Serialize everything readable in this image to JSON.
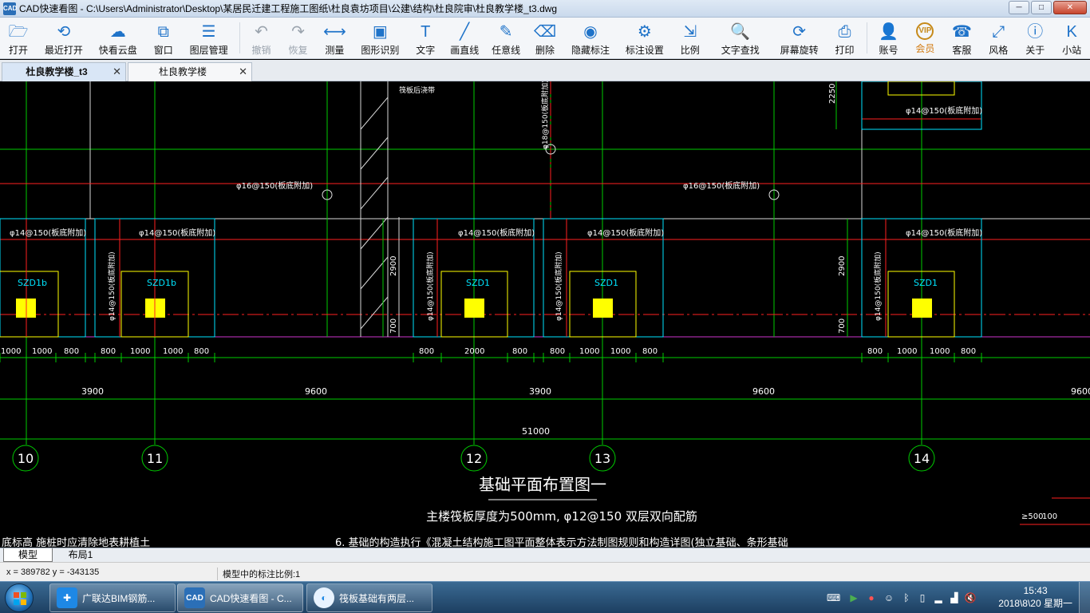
{
  "window": {
    "title": "CAD快速看图 - C:\\Users\\Administrator\\Desktop\\某居民迁建工程施工图纸\\杜良袁坊项目\\公建\\结构\\杜良院审\\杜良教学楼_t3.dwg",
    "minimize": "─",
    "maximize": "□",
    "close": "✕"
  },
  "toolbar": {
    "items": [
      {
        "label": "打开",
        "icon": "folder-open-icon",
        "glyph": "🗁"
      },
      {
        "label": "最近打开",
        "icon": "history-icon",
        "glyph": "⟲"
      },
      {
        "label": "快看云盘",
        "icon": "cloud-icon",
        "glyph": "☁"
      },
      {
        "label": "窗口",
        "icon": "window-icon",
        "glyph": "⧉"
      },
      {
        "label": "图层管理",
        "icon": "layers-icon",
        "glyph": "☰"
      },
      {
        "label": "撤销",
        "icon": "undo-icon",
        "glyph": "↶",
        "disabled": true
      },
      {
        "label": "恢复",
        "icon": "redo-icon",
        "glyph": "↷",
        "disabled": true
      },
      {
        "label": "测量",
        "icon": "ruler-icon",
        "glyph": "⟷"
      },
      {
        "label": "图形识别",
        "icon": "shape-recognition-icon",
        "glyph": "▣"
      },
      {
        "label": "文字",
        "icon": "text-icon",
        "glyph": "T"
      },
      {
        "label": "画直线",
        "icon": "line-icon",
        "glyph": "╱"
      },
      {
        "label": "任意线",
        "icon": "freehand-icon",
        "glyph": "✎"
      },
      {
        "label": "删除",
        "icon": "eraser-icon",
        "glyph": "⌫"
      },
      {
        "label": "隐藏标注",
        "icon": "eye-hide-icon",
        "glyph": "◉"
      },
      {
        "label": "标注设置",
        "icon": "annotation-settings-icon",
        "glyph": "⚙"
      },
      {
        "label": "比例",
        "icon": "scale-icon",
        "glyph": "⇲"
      },
      {
        "label": "文字查找",
        "icon": "text-search-icon",
        "glyph": "🔍"
      },
      {
        "label": "屏幕旋转",
        "icon": "rotate-screen-icon",
        "glyph": "⟳"
      },
      {
        "label": "打印",
        "icon": "printer-icon",
        "glyph": "⎙"
      },
      {
        "label": "账号",
        "icon": "user-icon",
        "glyph": "👤"
      },
      {
        "label": "会员",
        "icon": "vip-icon",
        "glyph": "VIP",
        "vip": true
      },
      {
        "label": "客服",
        "icon": "headset-icon",
        "glyph": "☎"
      },
      {
        "label": "风格",
        "icon": "style-icon",
        "glyph": "⤢"
      },
      {
        "label": "关于",
        "icon": "info-icon",
        "glyph": "ⓘ"
      },
      {
        "label": "小站",
        "icon": "k-logo-icon",
        "glyph": "K"
      }
    ]
  },
  "doc_tabs": [
    {
      "label": "杜良教学楼_t3",
      "active": true
    },
    {
      "label": "杜良教学楼",
      "active": false
    }
  ],
  "drawing": {
    "rebar_top": "φ16@150(板底附加)",
    "rebar_top_right": "φ16@150(板底附加)",
    "rebar_vertical": "φ18@150(板底附加)",
    "rebar_14": "φ14@150(板底附加)",
    "rebar_14_short": "φ14@150(板底附加)",
    "rebar_side": "φ14@150(板底附加)",
    "col_szd1b": "SZD1b",
    "col_szd1": "SZD1",
    "dim_2250": "2250",
    "dim_2900": "2900",
    "dim_700": "700",
    "dims_row1": [
      "1000",
      "1000",
      "800",
      "800",
      "1000",
      "1000",
      "800",
      "800",
      "2000",
      "800",
      "800",
      "1000",
      "1000",
      "800",
      "800",
      "1000",
      "1000",
      "800"
    ],
    "dims_row2": [
      "3900",
      "9600",
      "3900",
      "9600",
      "9600"
    ],
    "dim_total": "51000",
    "axes": [
      "10",
      "11",
      "12",
      "13",
      "14"
    ],
    "plan_title": "基础平面布置图一",
    "plan_note": "主楼筏板厚度为500mm, φ12@150 双层双向配筋",
    "bottom_left_note": "底标高  施桩时应清除地表耕植土",
    "bottom_note": "6.  基础的构造执行《混凝土结构施工图平面整体表示方法制图规则和构造详图(独立基础、条形基础",
    "right_dim_a": "≥500",
    "right_dim_b": "100",
    "top_label": "筏板后浇带",
    "colors": {
      "green": "#00ff00",
      "red": "#ff2020",
      "white": "#ffffff",
      "cyan": "#00e5ff",
      "yellow": "#ffff00",
      "magenta": "#ff40ff"
    }
  },
  "layout_tabs": [
    {
      "label": "模型",
      "active": true
    },
    {
      "label": "布局1",
      "active": false
    }
  ],
  "status": {
    "coords": "x = 389782  y = -343135",
    "scale_text": "模型中的标注比例:1"
  },
  "taskbar": {
    "items": [
      {
        "label": "广联达BIM钢筋...",
        "icon": "glodon-icon"
      },
      {
        "label": "CAD快速看图 - C...",
        "icon": "cad-viewer-icon"
      },
      {
        "label": "筏板基础有两层...",
        "icon": "browser-icon"
      }
    ],
    "time": "15:43",
    "date": "2018\\8\\20 星期一"
  }
}
